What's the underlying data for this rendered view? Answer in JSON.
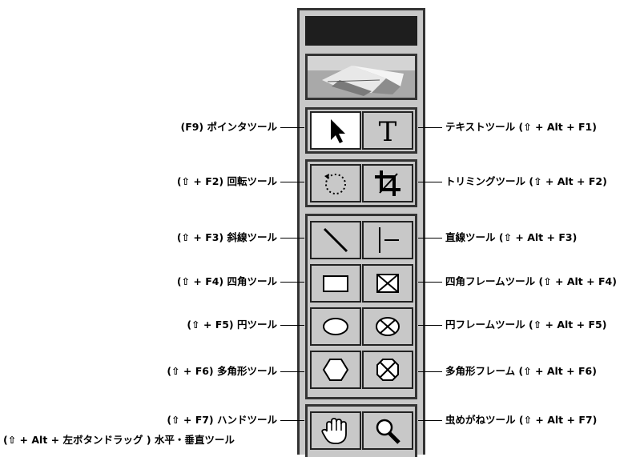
{
  "shift_symbol": "shift-arrow-icon",
  "rows": [
    {
      "left": "(F9) ポインタツール",
      "right": "テキストツール (⇧ + Alt + F1)",
      "left_tool": "pointer-tool",
      "right_tool": "text-tool",
      "right_glyph": "T"
    },
    {
      "left": "(⇧ + F2) 回転ツール",
      "right": "トリミングツール (⇧ + Alt + F2)",
      "left_tool": "rotate-tool",
      "right_tool": "crop-tool"
    },
    {
      "left": "(⇧ + F3) 斜線ツール",
      "right": "直線ツール (⇧ + Alt + F3)",
      "left_tool": "diagonal-line-tool",
      "right_tool": "straight-line-tool"
    },
    {
      "left": "(⇧ + F4) 四角ツール",
      "right": "四角フレームツール (⇧ + Alt + F4)",
      "left_tool": "rectangle-tool",
      "right_tool": "rectangle-frame-tool"
    },
    {
      "left": "(⇧ + F5) 円ツール",
      "right": "円フレームツール (⇧ + Alt + F5)",
      "left_tool": "ellipse-tool",
      "right_tool": "ellipse-frame-tool"
    },
    {
      "left": "(⇧ + F6) 多角形ツール",
      "right": "多角形フレーム (⇧ + Alt + F6)",
      "left_tool": "polygon-tool",
      "right_tool": "polygon-frame-tool"
    },
    {
      "left": "(⇧ + F7) ハンドツール",
      "left2": "(⇧ + Alt + 左ボタンドラッグ ) 水平・垂直ツール",
      "right": "虫めがねツール (⇧ + Alt + F7)",
      "left_tool": "hand-tool",
      "right_tool": "zoom-tool"
    }
  ]
}
